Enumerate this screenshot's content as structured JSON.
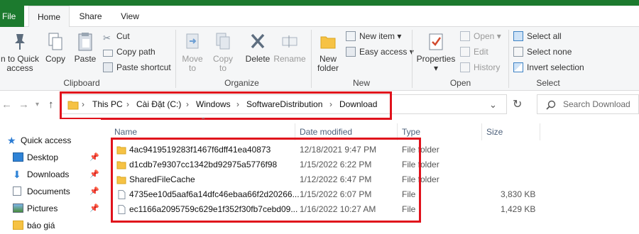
{
  "window": {
    "title": "Download"
  },
  "ribbon_tabs": [
    "File",
    "Home",
    "Share",
    "View"
  ],
  "ribbon": {
    "pin_label_line1": "n to Quick",
    "pin_label_line2": "access",
    "copy": "Copy",
    "paste": "Paste",
    "cut": "Cut",
    "copy_path": "Copy path",
    "paste_shortcut": "Paste shortcut",
    "clipboard": "Clipboard",
    "move_to_line1": "Move",
    "move_to_line2": "to",
    "copy_to_line1": "Copy",
    "copy_to_line2": "to",
    "delete": "Delete",
    "rename": "Rename",
    "organize": "Organize",
    "new_folder_line1": "New",
    "new_folder_line2": "folder",
    "new_item": "New item",
    "easy_access": "Easy access",
    "new": "New",
    "properties": "Properties",
    "open_btn": "Open",
    "edit": "Edit",
    "history": "History",
    "open_group": "Open",
    "select_all": "Select all",
    "select_none": "Select none",
    "invert_selection": "Invert selection",
    "select_group": "Select"
  },
  "address": {
    "crumbs": [
      "This PC",
      "Cài Đặt (C:)",
      "Windows",
      "SoftwareDistribution",
      "Download"
    ],
    "search_placeholder": "Search Download"
  },
  "sidebar": {
    "items": [
      {
        "label": "Quick access",
        "icon": "star-icon"
      },
      {
        "label": "Desktop",
        "icon": "desktop-icon",
        "pinned": true
      },
      {
        "label": "Downloads",
        "icon": "download-icon",
        "pinned": true
      },
      {
        "label": "Documents",
        "icon": "documents-icon",
        "pinned": true
      },
      {
        "label": "Pictures",
        "icon": "pictures-icon",
        "pinned": true
      },
      {
        "label": "báo giá",
        "icon": "folder-icon"
      }
    ]
  },
  "columns": [
    "Name",
    "Date modified",
    "Type",
    "Size"
  ],
  "files": [
    {
      "name": "4ac9419519283f1467f6dff41ea40873",
      "date": "12/18/2021 9:47 PM",
      "type": "File folder",
      "size": "",
      "kind": "folder"
    },
    {
      "name": "d1cdb7e9307cc1342bd92975a5776f98",
      "date": "1/15/2022 6:22 PM",
      "type": "File folder",
      "size": "",
      "kind": "folder"
    },
    {
      "name": "SharedFileCache",
      "date": "1/12/2022 6:47 PM",
      "type": "File folder",
      "size": "",
      "kind": "folder"
    },
    {
      "name": "4735ee10d5aaf6a14dfc46ebaa66f2d20266...",
      "date": "1/15/2022 6:07 PM",
      "type": "File",
      "size": "3,830 KB",
      "kind": "file"
    },
    {
      "name": "ec1166a2095759c629e1f352f30fb7cebd09...",
      "date": "1/16/2022 10:27 AM",
      "type": "File",
      "size": "1,429 KB",
      "kind": "file"
    }
  ],
  "colors": {
    "accent_green": "#1c7a2e",
    "highlight_red": "#e0121c",
    "folder_yellow": "#f6c244"
  }
}
